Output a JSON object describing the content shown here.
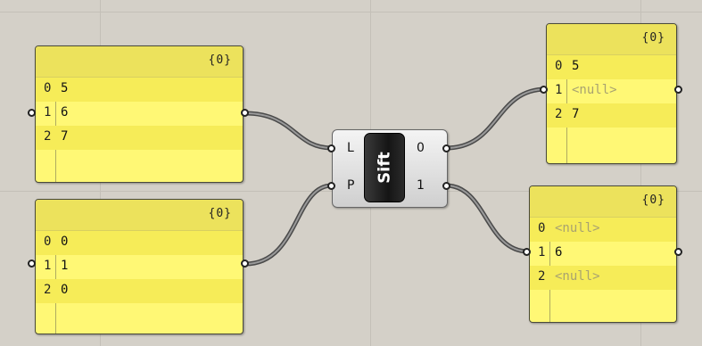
{
  "canvas": {
    "background": "#d4d0c8",
    "panel_color": "#fff875",
    "null_color": "#a8a270"
  },
  "panels": {
    "input_top": {
      "path": "{0}",
      "rows": [
        {
          "index": "0",
          "value": "5"
        },
        {
          "index": "1",
          "value": "6"
        },
        {
          "index": "2",
          "value": "7"
        }
      ]
    },
    "input_bottom": {
      "path": "{0}",
      "rows": [
        {
          "index": "0",
          "value": "0"
        },
        {
          "index": "1",
          "value": "1"
        },
        {
          "index": "2",
          "value": "0"
        }
      ]
    },
    "output_top": {
      "path": "{0}",
      "rows": [
        {
          "index": "0",
          "value": "5"
        },
        {
          "index": "1",
          "value": "<null>"
        },
        {
          "index": "2",
          "value": "7"
        }
      ]
    },
    "output_bottom": {
      "path": "{0}",
      "rows": [
        {
          "index": "0",
          "value": "<null>"
        },
        {
          "index": "1",
          "value": "6"
        },
        {
          "index": "2",
          "value": "<null>"
        }
      ]
    }
  },
  "component": {
    "name": "Sift",
    "inputs": [
      "L",
      "P"
    ],
    "outputs": [
      "0",
      "1"
    ]
  }
}
